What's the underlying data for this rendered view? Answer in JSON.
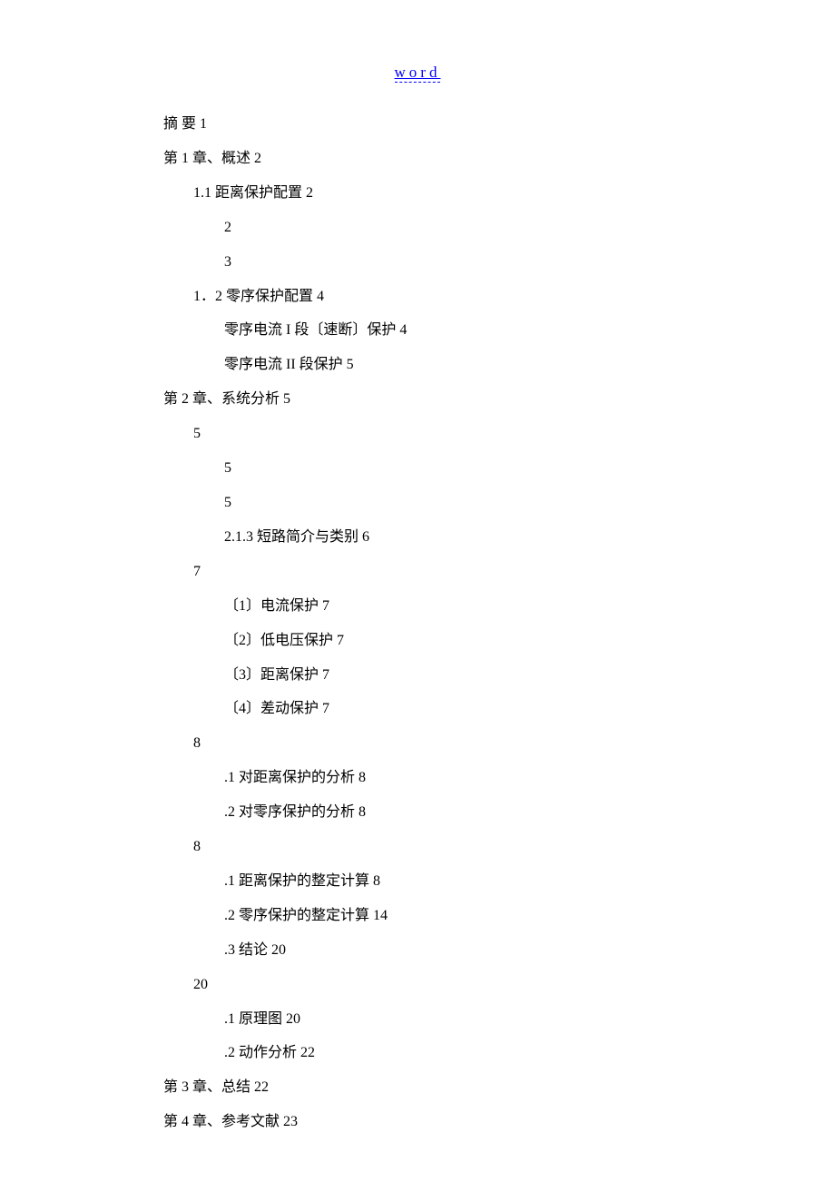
{
  "header": {
    "link_text": "word"
  },
  "toc": [
    {
      "level": 0,
      "text": "摘 要 1"
    },
    {
      "level": 0,
      "text": "第 1 章、概述 2"
    },
    {
      "level": 1,
      "text": "1.1 距离保护配置 2"
    },
    {
      "level": 2,
      "text": " 2"
    },
    {
      "level": 2,
      "text": " 3"
    },
    {
      "level": 1,
      "text": "1．2 零序保护配置 4"
    },
    {
      "level": 2,
      "text": " 零序电流 I 段〔速断〕保护 4"
    },
    {
      "level": 2,
      "text": " 零序电流 II 段保护 5"
    },
    {
      "level": 0,
      "text": "第 2 章、系统分析 5"
    },
    {
      "level": 1,
      "text": " 5"
    },
    {
      "level": 2,
      "text": " 5"
    },
    {
      "level": 2,
      "text": " 5"
    },
    {
      "level": 2,
      "text": "2.1.3  短路简介与类别 6"
    },
    {
      "level": 1,
      "text": " 7"
    },
    {
      "level": 2,
      "text": "〔1〕电流保护 7"
    },
    {
      "level": 2,
      "text": "〔2〕低电压保护 7"
    },
    {
      "level": 2,
      "text": "〔3〕距离保护 7"
    },
    {
      "level": 2,
      "text": "〔4〕差动保护 7"
    },
    {
      "level": 1,
      "text": " 8"
    },
    {
      "level": 2,
      "text": ".1 对距离保护的分析 8"
    },
    {
      "level": 2,
      "text": ".2 对零序保护的分析 8"
    },
    {
      "level": 1,
      "text": " 8"
    },
    {
      "level": 2,
      "text": ".1 距离保护的整定计算 8"
    },
    {
      "level": 2,
      "text": ".2 零序保护的整定计算 14"
    },
    {
      "level": 2,
      "text": ".3 结论 20"
    },
    {
      "level": 1,
      "text": " 20"
    },
    {
      "level": 2,
      "text": ".1 原理图 20"
    },
    {
      "level": 2,
      "text": ".2 动作分析 22"
    },
    {
      "level": 0,
      "text": "第 3 章、总结 22"
    },
    {
      "level": 0,
      "text": "第 4 章、参考文献 23"
    }
  ]
}
